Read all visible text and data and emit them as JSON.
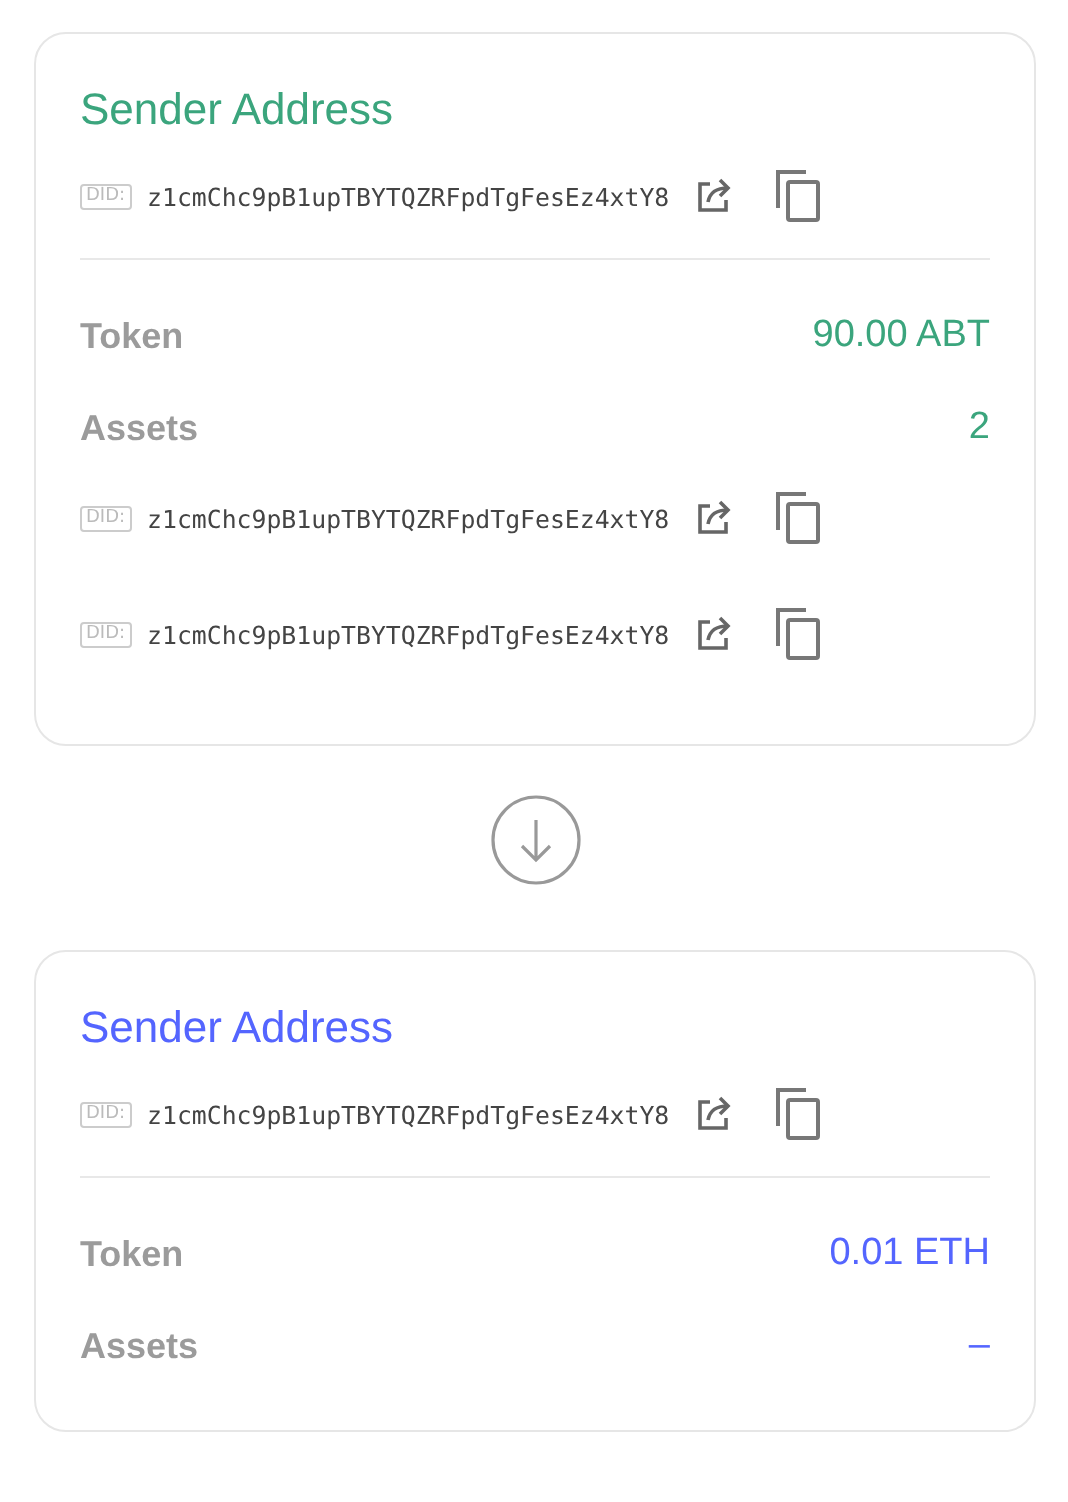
{
  "cards": [
    {
      "title": "Sender Address",
      "color": "#3ba57d",
      "address": {
        "badge": "DID:",
        "value": "z1cmChc9pB1upTBYTQZRFpdTgFesEz4xtY8"
      },
      "token": {
        "label": "Token",
        "value": "90.00 ABT"
      },
      "assets": {
        "label": "Assets",
        "value": "2",
        "items": [
          {
            "badge": "DID:",
            "value": "z1cmChc9pB1upTBYTQZRFpdTgFesEz4xtY8"
          },
          {
            "badge": "DID:",
            "value": "z1cmChc9pB1upTBYTQZRFpdTgFesEz4xtY8"
          }
        ]
      }
    },
    {
      "title": "Sender Address",
      "color": "#5465ff",
      "address": {
        "badge": "DID:",
        "value": "z1cmChc9pB1upTBYTQZRFpdTgFesEz4xtY8"
      },
      "token": {
        "label": "Token",
        "value": "0.01 ETH"
      },
      "assets": {
        "label": "Assets",
        "value": "–"
      }
    }
  ]
}
